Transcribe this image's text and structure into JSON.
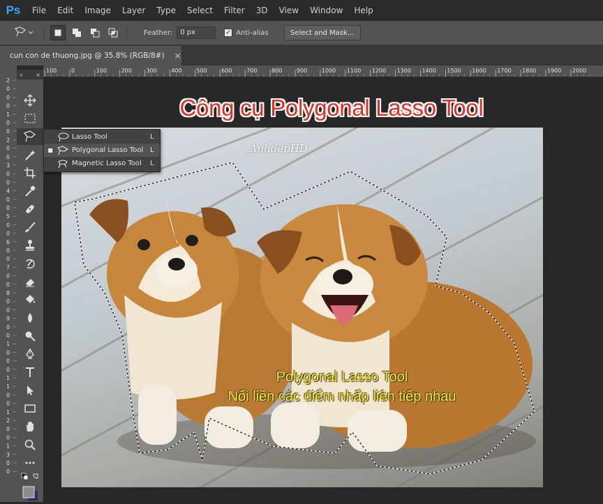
{
  "app": {
    "logo": "Ps",
    "menu": [
      "File",
      "Edit",
      "Image",
      "Layer",
      "Type",
      "Select",
      "Filter",
      "3D",
      "View",
      "Window",
      "Help"
    ]
  },
  "options_bar": {
    "tool_icon": "polygonal-lasso-icon",
    "feather_label": "Feather:",
    "feather_value": "0 px",
    "antialias_label": "Anti-alias",
    "antialias_checked": "✓",
    "mask_button": "Select and Mask..."
  },
  "document_tab": {
    "title": "cun con de thuong.jpg @ 35.8% (RGB/8#)",
    "close": "×"
  },
  "rulers": {
    "top_ticks": [
      "100",
      "0",
      "100",
      "200",
      "300",
      "400",
      "500",
      "600",
      "700",
      "800",
      "900",
      "1000",
      "1100",
      "1200",
      "1300",
      "1400",
      "1500",
      "1600",
      "1700",
      "1800",
      "1900",
      "2000"
    ],
    "left_ticks": [
      "2",
      "0",
      "0",
      "0",
      "1",
      "0",
      "0",
      "2",
      "0",
      "0",
      "3",
      "0",
      "0",
      "4",
      "0",
      "0",
      "5",
      "0",
      "0",
      "6",
      "0",
      "0",
      "7",
      "0",
      "0",
      "8",
      "0",
      "0",
      "9",
      "0",
      "0",
      "1",
      "0",
      "0",
      "0",
      "1",
      "1",
      "0",
      "0",
      "1",
      "2",
      "0",
      "0",
      "1",
      "3",
      "0",
      "0"
    ]
  },
  "toolbox": {
    "collapse": "»",
    "close": "×",
    "tools": [
      "move-icon",
      "marquee-icon",
      "lasso-icon",
      "magic-wand-icon",
      "crop-icon",
      "eyedropper-icon",
      "healing-brush-icon",
      "brush-icon",
      "clone-stamp-icon",
      "history-brush-icon",
      "eraser-icon",
      "paint-bucket-icon",
      "blur-icon",
      "dodge-icon",
      "pen-icon",
      "type-icon",
      "path-selection-icon",
      "rectangle-icon",
      "hand-icon",
      "zoom-icon",
      "more-icon"
    ]
  },
  "flyout": {
    "items": [
      {
        "label": "Lasso Tool",
        "key": "L",
        "icon": "lasso-icon",
        "active": false
      },
      {
        "label": "Polygonal Lasso Tool",
        "key": "L",
        "icon": "polygonal-lasso-icon",
        "active": true
      },
      {
        "label": "Magnetic Lasso Tool",
        "key": "L",
        "icon": "magnetic-lasso-icon",
        "active": false
      }
    ]
  },
  "image": {
    "heading": "Công cụ Polygonal Lasso Tool",
    "watermark": "_AnhdepHD",
    "caption_line1": "Polygonal Lasso Tool",
    "caption_line2": "Nối liền các điểm nhấp liên tiếp nhau"
  },
  "colors": {
    "accent": "#31a8ff",
    "heading": "#e03026",
    "caption": "#ffeb1e"
  }
}
